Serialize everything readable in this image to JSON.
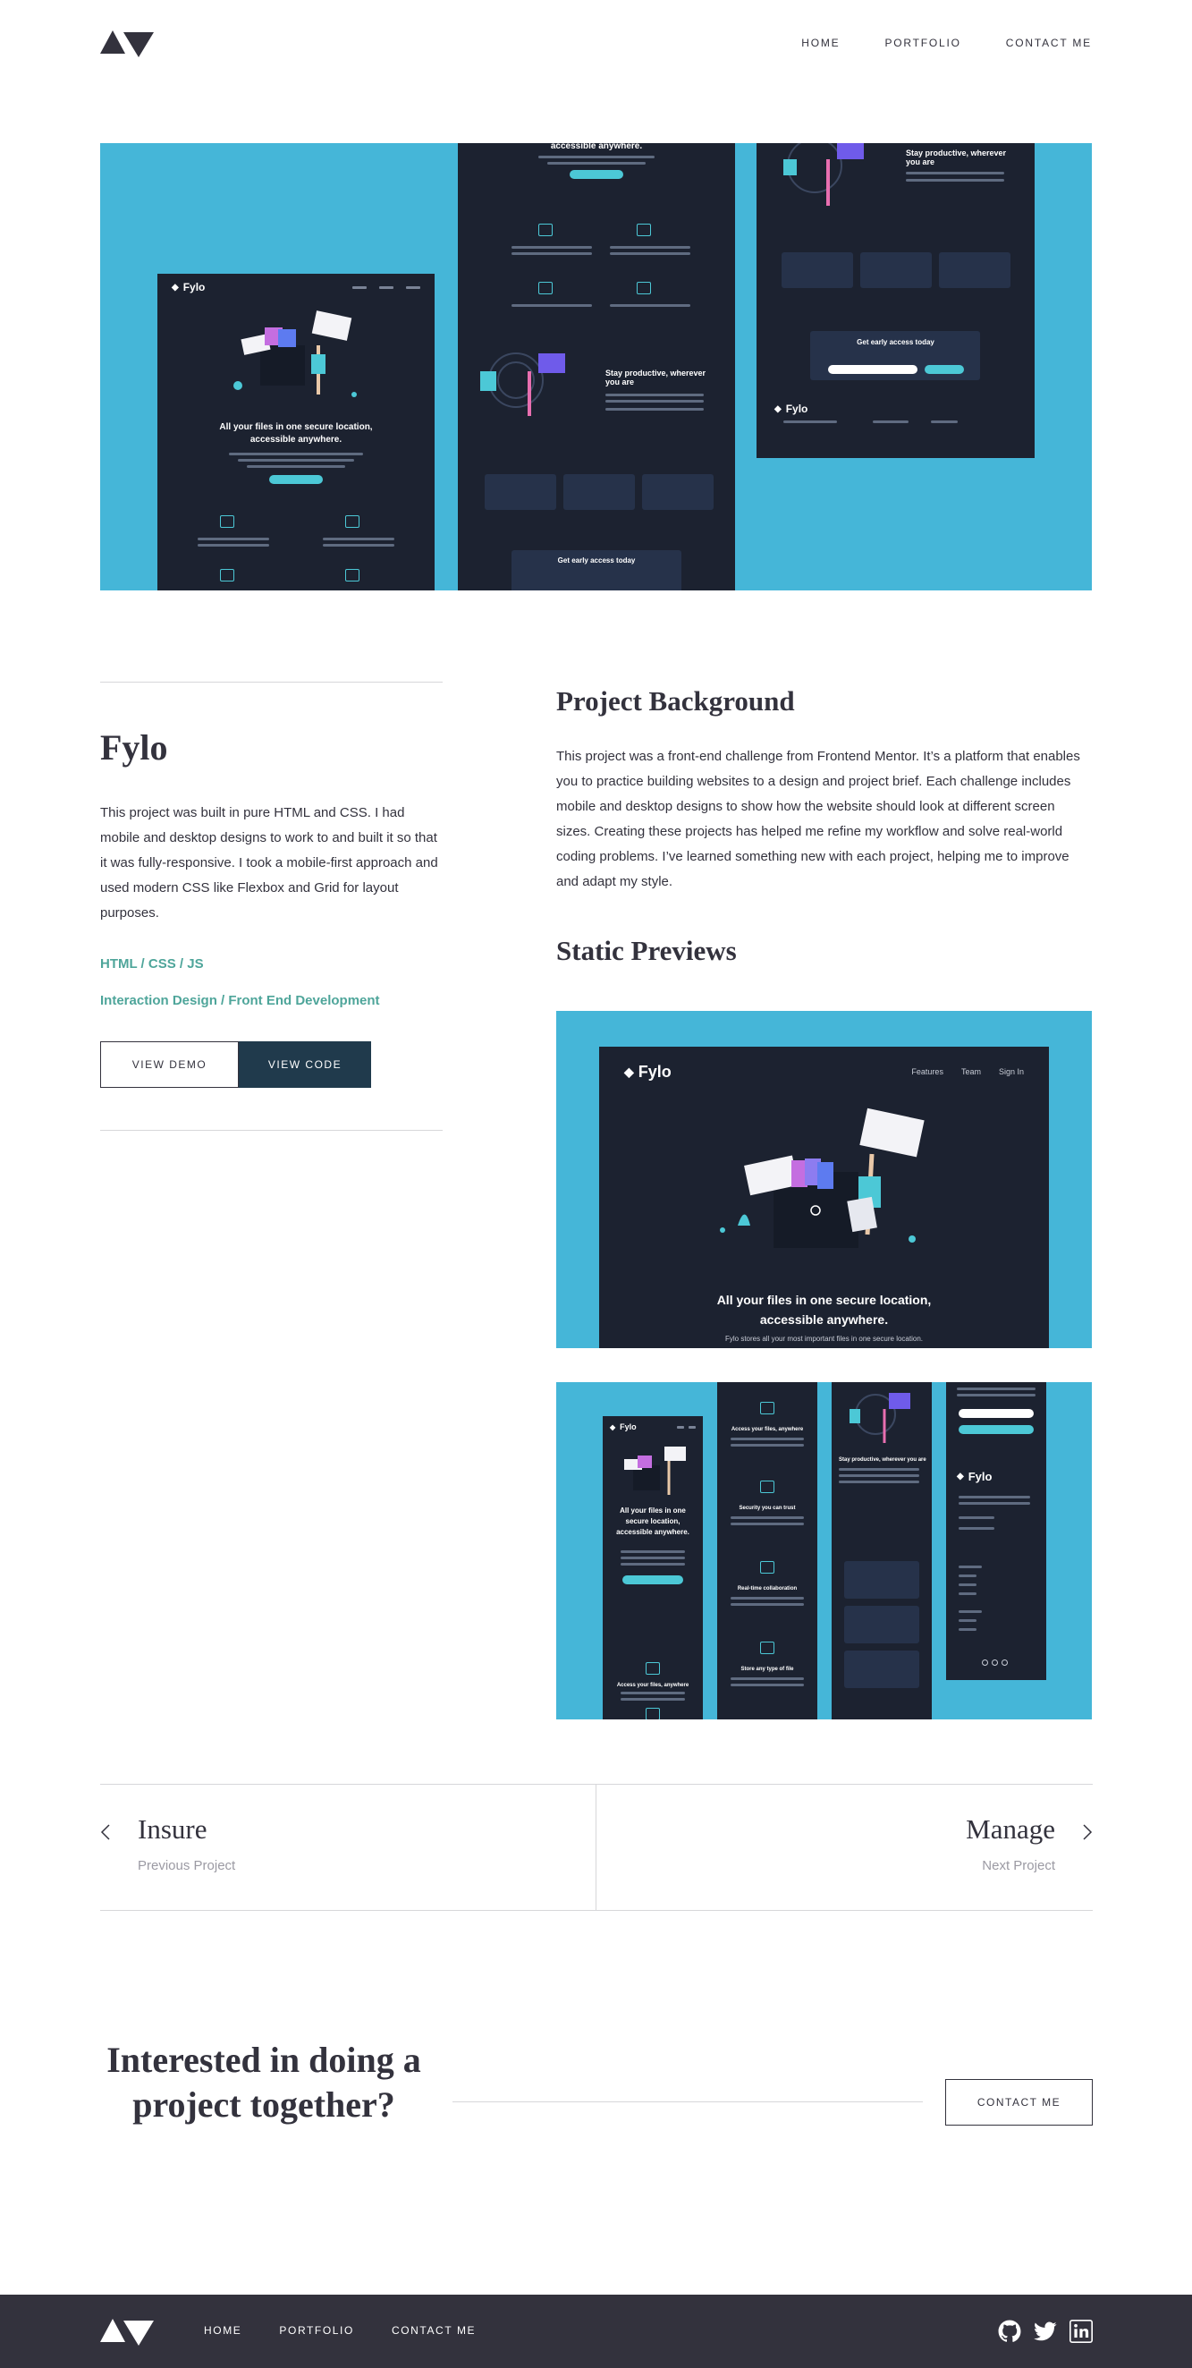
{
  "brand": {
    "logo_icon": "triangles-logo-icon"
  },
  "nav": {
    "home": "HOME",
    "portfolio": "PORTFOLIO",
    "contact": "CONTACT ME"
  },
  "colors": {
    "hero_bg": "#45b6d8",
    "dark": "#33323d",
    "accent": "#4ea59a",
    "button_dark": "#203a4c",
    "mock_bg": "#1c2230",
    "mock_accent": "#4cc8d6"
  },
  "mockups": {
    "logo": "Fylo",
    "nav_links": [
      "Features",
      "Team",
      "Sign In"
    ],
    "hero_headline": "All your files in one secure location, accessible anywhere.",
    "hero_headline_mobile": "All your files in one secure location, accessible anywhere.",
    "hero_line": "Fylo stores all your most important files in one secure location.",
    "hero_headline_top": "accessible anywhere.",
    "features": [
      "Access your files, anywhere",
      "Security you can trust",
      "Real-time collaboration",
      "Store any type of file"
    ],
    "stay_productive": "Stay productive, wherever you are",
    "get_early_access": "Get early access today"
  },
  "project": {
    "title": "Fylo",
    "description": "This project was built in pure HTML and CSS. I had mobile and desktop designs to work to and built it so that it was fully-responsive. I took a mobile-first approach and used modern CSS like Flexbox and Grid for layout purposes.",
    "tech": "HTML / CSS / JS",
    "skills": "Interaction Design / Front End Development",
    "view_demo": "VIEW DEMO",
    "view_code": "VIEW CODE"
  },
  "background": {
    "heading": "Project Background",
    "text": "This project was a front-end challenge from Frontend Mentor. It’s a platform that enables you to practice building websites to a design and project brief. Each challenge includes mobile and desktop designs to show how the website should look at different screen sizes. Creating these projects has helped me refine my workflow and solve real-world coding problems. I’ve learned something new with each project, helping me to improve and adapt my style."
  },
  "previews": {
    "heading": "Static Previews"
  },
  "pagination": {
    "prev_title": "Insure",
    "prev_label": "Previous Project",
    "next_title": "Manage",
    "next_label": "Next Project"
  },
  "cta": {
    "title": "Interested in doing a project together?",
    "button": "CONTACT ME"
  },
  "footer": {
    "home": "HOME",
    "portfolio": "PORTFOLIO",
    "contact": "CONTACT ME",
    "social_icons": [
      "github-icon",
      "twitter-icon",
      "linkedin-icon"
    ]
  }
}
